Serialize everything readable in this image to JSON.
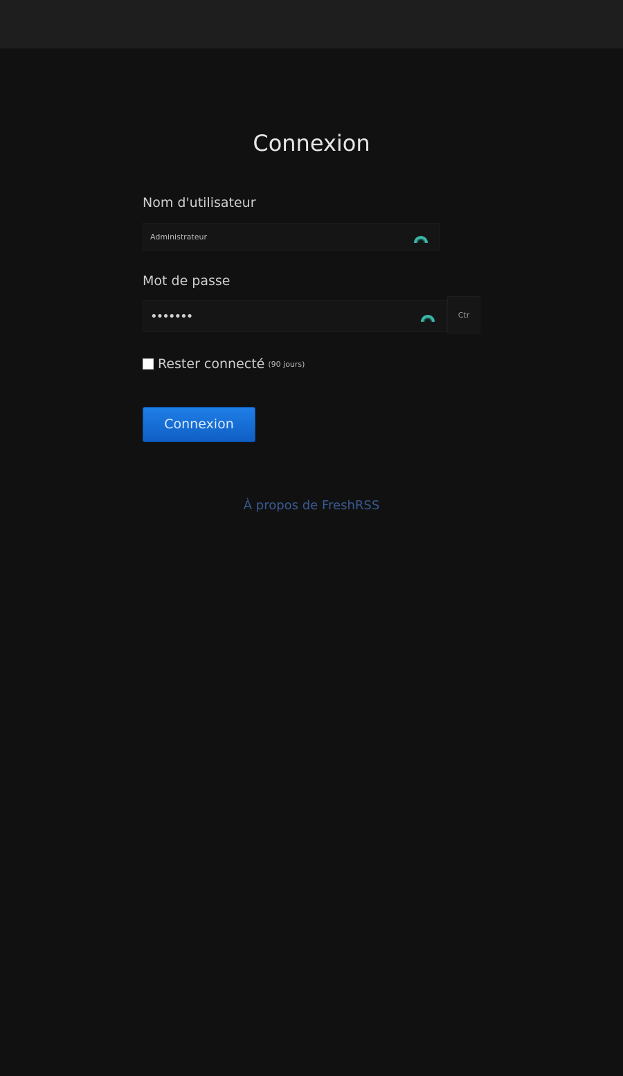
{
  "page": {
    "title": "Connexion"
  },
  "form": {
    "username_label": "Nom d'utilisateur",
    "username_value": "Administrateur",
    "password_label": "Mot de passe",
    "password_value": "•••••••",
    "password_toggle_label": "Ctr",
    "remember_label": "Rester connecté",
    "remember_hint": "(90 jours)",
    "remember_checked": false,
    "submit_label": "Connexion"
  },
  "footer": {
    "about_link": "À propos de FreshRSS"
  },
  "colors": {
    "background": "#111112",
    "accent": "#1a73e0",
    "password_manager_icon": "#3bb6a6",
    "link": "#3a5a91"
  },
  "icons": {
    "password_manager": "password-manager-icon"
  }
}
